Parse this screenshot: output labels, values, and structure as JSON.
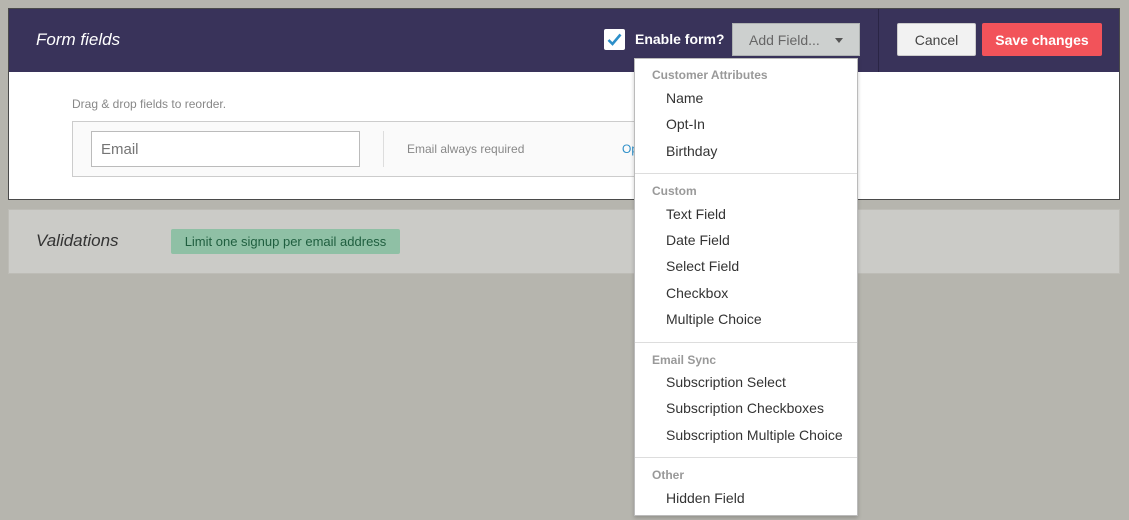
{
  "header": {
    "title": "Form fields",
    "enable_label": "Enable form?",
    "enable_checked": true,
    "add_field_label": "Add Field...",
    "cancel_label": "Cancel",
    "save_label": "Save changes"
  },
  "form": {
    "drag_hint": "Drag & drop fields to reorder.",
    "email_placeholder": "Email",
    "email_note": "Email always required",
    "link_text": "Op"
  },
  "validations": {
    "title": "Validations",
    "tag": "Limit one signup per email address"
  },
  "dropdown": {
    "groups": [
      {
        "label": "Customer Attributes",
        "items": [
          "Name",
          "Opt-In",
          "Birthday"
        ]
      },
      {
        "label": "Custom",
        "items": [
          "Text Field",
          "Date Field",
          "Select Field",
          "Checkbox",
          "Multiple Choice"
        ]
      },
      {
        "label": "Email Sync",
        "items": [
          "Subscription Select",
          "Subscription Checkboxes",
          "Subscription Multiple Choice"
        ]
      },
      {
        "label": "Other",
        "items": [
          "Hidden Field"
        ]
      }
    ]
  },
  "colors": {
    "header_bg": "#39335a",
    "save_bg": "#f2535a",
    "check_color": "#2c8fc9",
    "tag_bg": "#8fc0a5"
  }
}
